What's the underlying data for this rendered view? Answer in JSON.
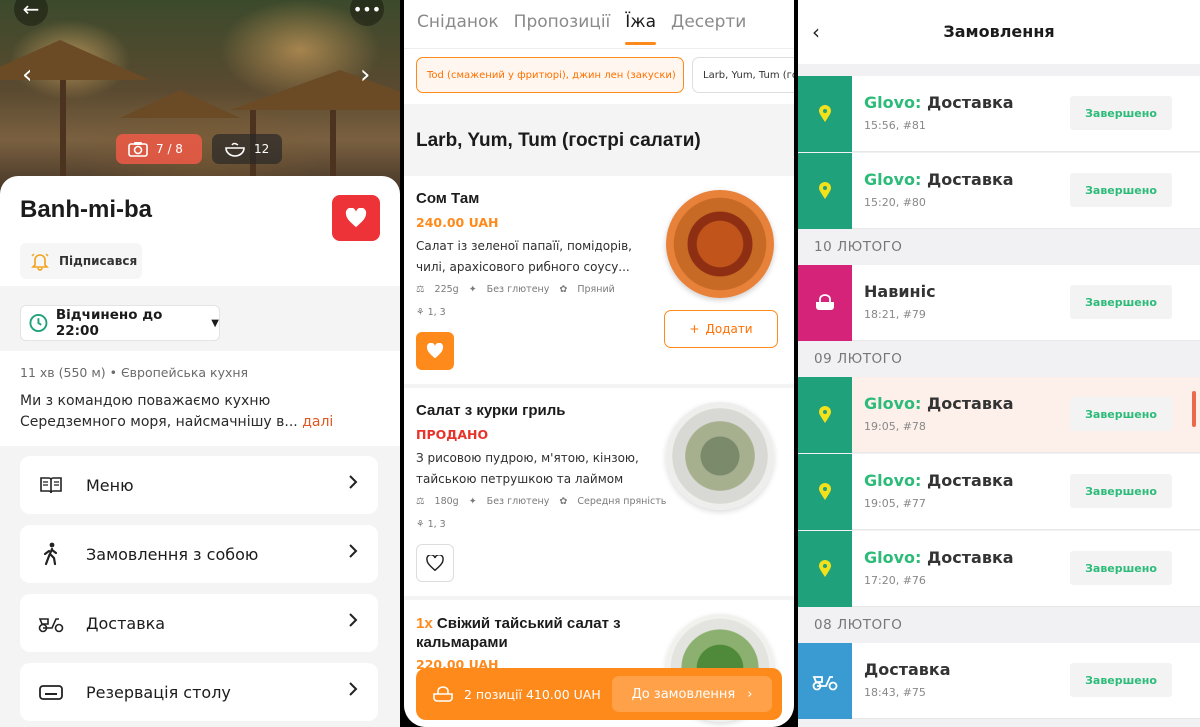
{
  "restaurant": {
    "name": "Banh-mi-ba",
    "photo_counter": "7 / 8",
    "dishes_count": "12",
    "subscribe_label": "Підписався",
    "hours": "Відчинено до 22:00",
    "meta": "11 хв (550 м)  •  Європейська кухня",
    "description": "Ми з командою поважаємо кухню Середземного моря, найсмачнішу в...",
    "more_link": "далі",
    "menu_items": [
      {
        "label": "Меню",
        "icon": "book-icon"
      },
      {
        "label": "Замовлення з собою",
        "icon": "walking-person-icon"
      },
      {
        "label": "Доставка",
        "icon": "scooter-icon"
      },
      {
        "label": "Резервація столу",
        "icon": "table-icon"
      }
    ],
    "accent": "#ee3338"
  },
  "menu": {
    "tabs": [
      "Сніданок",
      "Пропозиції",
      "Їжа",
      "Десерти"
    ],
    "active_tab": "Їжа",
    "filters": [
      {
        "label": "Tod (смажений у фритюрі), джин лен (закуски)",
        "active": true
      },
      {
        "label": "Larb, Yum, Tum (го",
        "active": false
      }
    ],
    "section_title": "Larb, Yum, Tum (гострі салати)",
    "dishes": [
      {
        "name": "Сом Там",
        "price": "240.00 UAH",
        "description": "Салат із зеленої папаїї, помідорів, чилі, арахісового рибного соусу...",
        "weight": "225g",
        "gluten": "Без глютену",
        "spice": "Пряний",
        "allergens": "1, 3",
        "add_label": "Додати"
      },
      {
        "name": "Салат з курки гриль",
        "price": "ПРОДАНО",
        "description": "З рисовою пудрою, м'ятою, кінзою, тайською петрушкою та лаймом",
        "weight": "180g",
        "gluten": "Без глютену",
        "spice": "Середня пряність",
        "allergens": "1, 3"
      },
      {
        "qty": "1x",
        "name": "Свіжий тайський салат з кальмарами",
        "price": "220.00 UAH"
      }
    ],
    "cart": {
      "summary": "2 позиції  410.00 UAH",
      "cta": "До замовлення"
    },
    "accent": "#ff8a1c"
  },
  "orders": {
    "title": "Замовлення",
    "groups": [
      {
        "date": null,
        "items": [
          {
            "brand": "Glovo:",
            "type": "Доставка",
            "time": "15:56, #81",
            "status": "Завершено",
            "icon": "location-pin-icon",
            "color": "#1fa27b"
          },
          {
            "brand": "Glovo:",
            "type": "Доставка",
            "time": "15:20, #80",
            "status": "Завершено",
            "icon": "location-pin-icon",
            "color": "#1fa27b"
          }
        ]
      },
      {
        "date": "10 ЛЮТОГО",
        "items": [
          {
            "brand": "",
            "type": "Навиніс",
            "time": "18:21, #79",
            "status": "Завершено",
            "icon": "takeaway-bag-icon",
            "color": "#d6237a"
          }
        ]
      },
      {
        "date": "09 ЛЮТОГО",
        "items": [
          {
            "brand": "Glovo:",
            "type": "Доставка",
            "time": "19:05, #78",
            "status": "Завершено",
            "icon": "location-pin-icon",
            "color": "#1fa27b",
            "highlight": true
          },
          {
            "brand": "Glovo:",
            "type": "Доставка",
            "time": "19:05, #77",
            "status": "Завершено",
            "icon": "location-pin-icon",
            "color": "#1fa27b"
          },
          {
            "brand": "Glovo:",
            "type": "Доставка",
            "time": "17:20, #76",
            "status": "Завершено",
            "icon": "location-pin-icon",
            "color": "#1fa27b"
          }
        ]
      },
      {
        "date": "08 ЛЮТОГО",
        "items": [
          {
            "brand": "",
            "type": "Доставка",
            "time": "18:43, #75",
            "status": "Завершено",
            "icon": "scooter-icon",
            "color": "#3a9bd2"
          }
        ]
      }
    ]
  }
}
